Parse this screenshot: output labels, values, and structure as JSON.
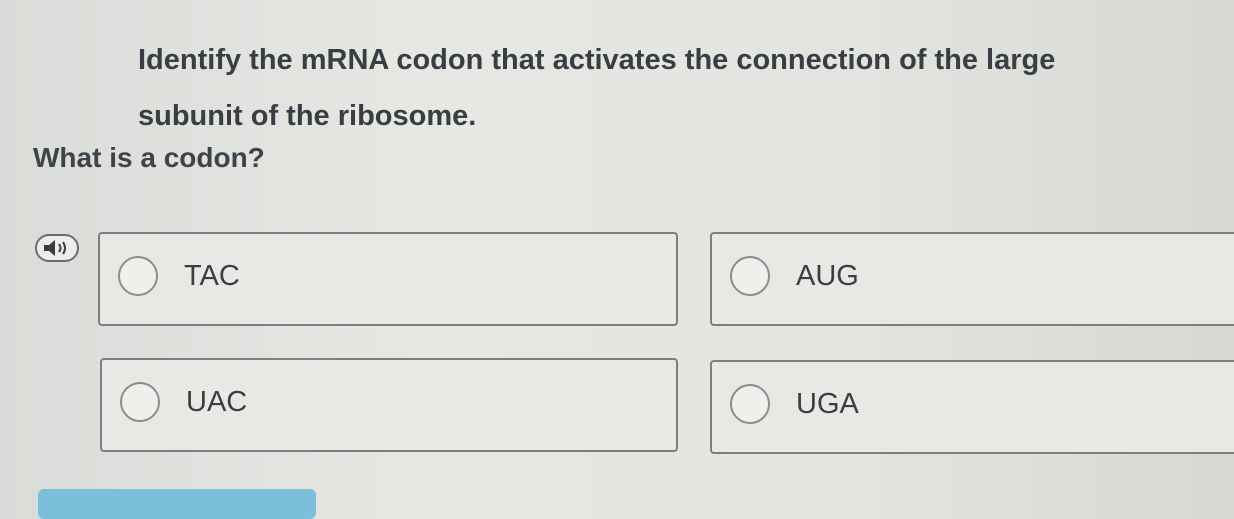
{
  "question": {
    "text": "Identify the mRNA codon that activates the connection of the large subunit of the ribosome."
  },
  "help_link": {
    "text": "What is a codon?"
  },
  "audio_button": {
    "icon": "speaker-icon"
  },
  "options": [
    {
      "label": "TAC"
    },
    {
      "label": "AUG"
    },
    {
      "label": "UAC"
    },
    {
      "label": "UGA"
    }
  ],
  "colors": {
    "background": "#e4e6e2",
    "text": "#3a3d44",
    "submit_button": "#7bbfd9"
  }
}
